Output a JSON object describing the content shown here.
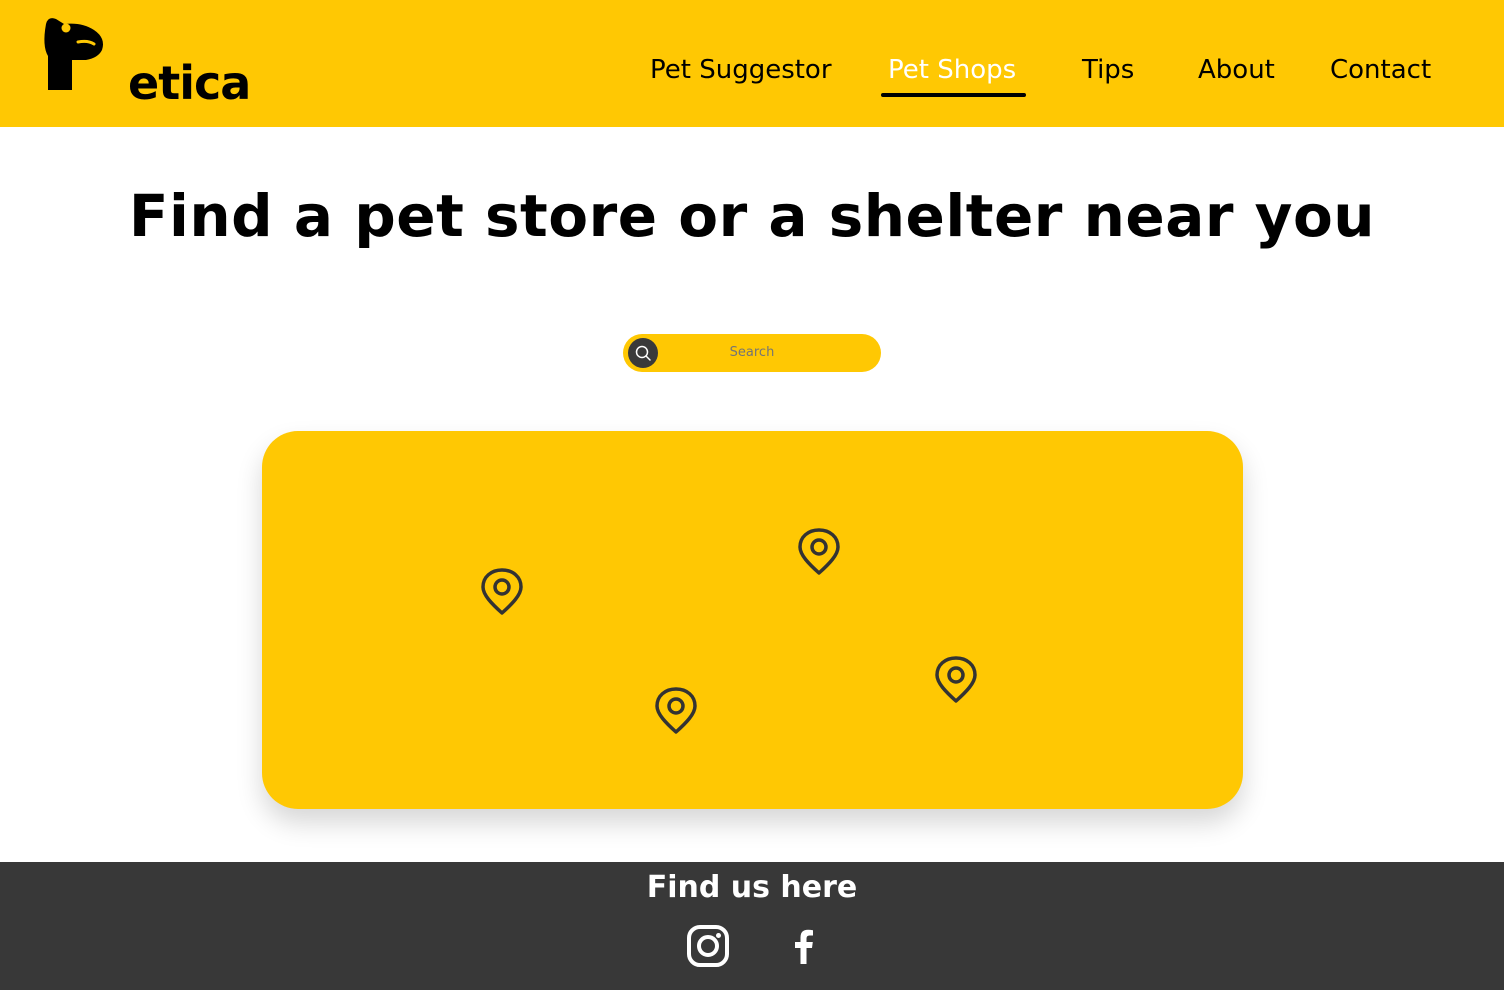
{
  "brand": {
    "name": "Petica",
    "color": "#FFC803"
  },
  "nav": {
    "items": [
      {
        "label": "Pet Suggestor",
        "active": false
      },
      {
        "label": "Pet Shops",
        "active": true
      },
      {
        "label": "Tips",
        "active": false
      },
      {
        "label": "About",
        "active": false
      },
      {
        "label": "Contact",
        "active": false
      }
    ]
  },
  "main": {
    "headline": "Find a pet store or a shelter near you",
    "search": {
      "placeholder": "Search",
      "icon": "search-icon"
    },
    "map": {
      "pin_count": 4,
      "pin_icon": "map-pin-icon"
    }
  },
  "footer": {
    "title": "Find us here",
    "social": [
      {
        "icon": "instagram-icon"
      },
      {
        "icon": "facebook-icon"
      }
    ],
    "background": "#383838"
  }
}
